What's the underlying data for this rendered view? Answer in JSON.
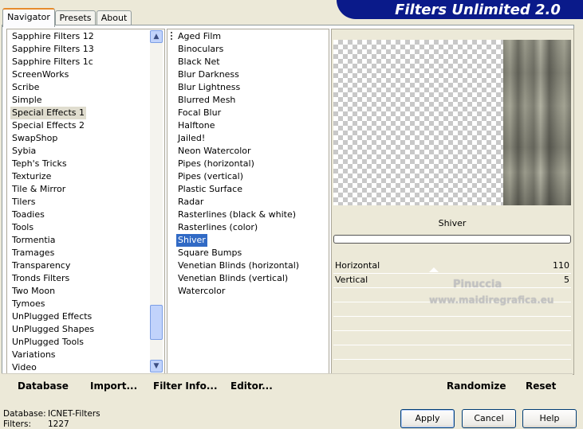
{
  "tabs": [
    "Navigator",
    "Presets",
    "About"
  ],
  "banner_title": "Filters Unlimited 2.0",
  "categories": [
    "Sapphire Filters 12",
    "Sapphire Filters 13",
    "Sapphire Filters 1c",
    "ScreenWorks",
    "Scribe",
    "Simple",
    "Special Effects 1",
    "Special Effects 2",
    "SwapShop",
    "Sybia",
    "Teph's Tricks",
    "Texturize",
    "Tile & Mirror",
    "Tilers",
    "Toadies",
    "Tools",
    "Tormentia",
    "Tramages",
    "Transparency",
    "Tronds Filters",
    "Two Moon",
    "Tymoes",
    "UnPlugged Effects",
    "UnPlugged Shapes",
    "UnPlugged Tools",
    "Variations",
    "Video"
  ],
  "selected_category": "Special Effects 1",
  "filters": [
    "Aged Film",
    "Binoculars",
    "Black Net",
    "Blur Darkness",
    "Blur Lightness",
    "Blurred Mesh",
    "Focal Blur",
    "Halftone",
    "Jailed!",
    "Neon Watercolor",
    "Pipes (horizontal)",
    "Pipes (vertical)",
    "Plastic Surface",
    "Radar",
    "Rasterlines (black & white)",
    "Rasterlines (color)",
    "Shiver",
    "Square Bumps",
    "Venetian Blinds (horizontal)",
    "Venetian Blinds (vertical)",
    "Watercolor"
  ],
  "selected_filter": "Shiver",
  "preview": {
    "filter_name": "Shiver",
    "progress": 0
  },
  "params": [
    {
      "label": "Horizontal",
      "value": "110"
    },
    {
      "label": "Vertical",
      "value": "5"
    }
  ],
  "watermark": {
    "line1": "Pinuccia",
    "line2": "www.maidiregrafica.eu"
  },
  "bottom_buttons": {
    "database": "Database",
    "import": "Import...",
    "filter_info": "Filter Info...",
    "editor": "Editor...",
    "randomize": "Randomize",
    "reset": "Reset"
  },
  "dialog_buttons": {
    "apply": "Apply",
    "cancel": "Cancel",
    "help": "Help"
  },
  "status": {
    "database_label": "Database:",
    "database_value": "ICNET-Filters",
    "filters_label": "Filters:",
    "filters_value": "1227"
  },
  "colors": {
    "banner": "#0a1a8a",
    "selection": "#316ac5",
    "dialog_bg": "#ece9d8"
  }
}
